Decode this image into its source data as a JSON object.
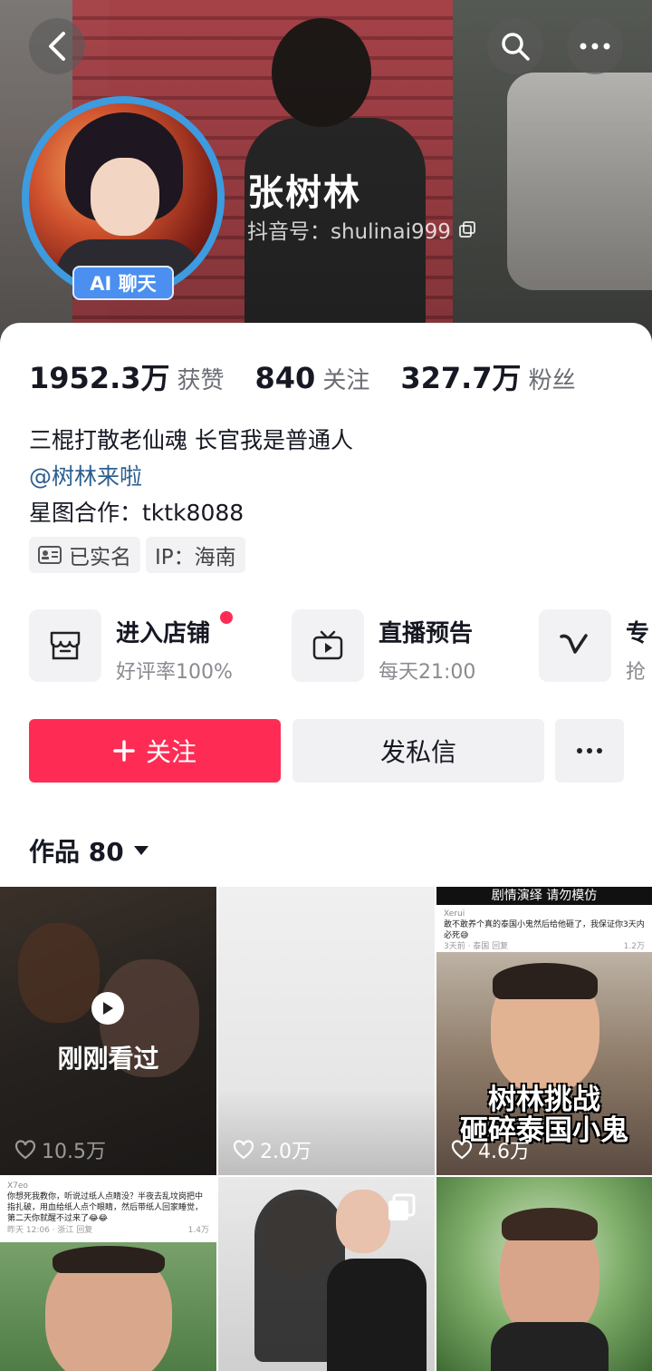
{
  "header": {
    "name": "张树林",
    "douyin_id": "抖音号：shulinai999",
    "ai_badge": "AI 聊天"
  },
  "stats": [
    {
      "value": "1952.3万",
      "label": "获赞"
    },
    {
      "value": "840",
      "label": "关注"
    },
    {
      "value": "327.7万",
      "label": "粉丝"
    }
  ],
  "bio": {
    "line1": "三棍打散老仙魂 长官我是普通人",
    "mention": "@树林来啦",
    "line3": "星图合作：tktk8088"
  },
  "chips": {
    "verified": "已实名",
    "ip": "IP：海南"
  },
  "services": [
    {
      "title": "进入店铺",
      "sub": "好评率100%",
      "icon": "store-icon"
    },
    {
      "title": "直播预告",
      "sub": "每天21:00",
      "icon": "tv-icon"
    },
    {
      "title": "专",
      "sub": "抢",
      "icon": "v-icon"
    }
  ],
  "actions": {
    "follow": "关注",
    "message": "发私信"
  },
  "works_tab": "作品 80",
  "videos": [
    {
      "likes": "10.5万",
      "overlay": "刚刚看过"
    },
    {
      "likes": "2.0万"
    },
    {
      "likes": "4.6万",
      "caption1": "树林挑战",
      "caption2": "砸碎泰国小鬼",
      "comment_user": "Xerui",
      "comment": "敢不敢养个真的泰国小鬼然后给他砸了，我保证你3天内必死😅",
      "comment_meta": "3天前 · 泰国   回复",
      "comment_likes": "1.2万",
      "banner": "剧情演绎 请勿模仿"
    },
    {
      "comment_user": "X7eo",
      "comment": "你想死我教你，听说过纸人点睛没？半夜去乱坟岗把中指扎破，用血给纸人点个眼睛，然后带纸人回家睡觉，第二天你就醒不过来了😂😂",
      "comment_meta": "昨天 12:06 · 浙江   回复",
      "comment_likes": "1.4万"
    },
    {},
    {}
  ],
  "colors": {
    "accent": "#fe2c55",
    "ai_badge": "#4b8ff0",
    "mention": "#2c5f8f"
  }
}
